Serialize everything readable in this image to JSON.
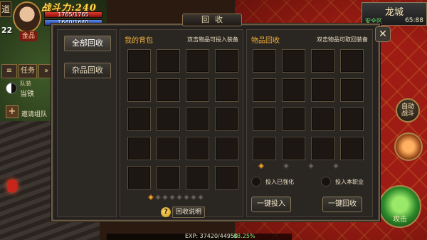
{
  "hud": {
    "dao": "道",
    "power": "战斗力:240",
    "level": "22",
    "hp_text": "1765/1765",
    "hp_fraction": 1.0,
    "mp_text": "1640/1640",
    "mp_fraction": 1.0,
    "name": "金品",
    "side_btn_task": "任务",
    "team_label": "队装",
    "team_name": "当铁",
    "invite": "邀请组队"
  },
  "map": {
    "name": "龙城",
    "safe": "安全区",
    "coords": "65:88"
  },
  "skills": {
    "fight": "自动\n战斗",
    "main": "攻击"
  },
  "exp": {
    "text": "EXP: 37420/44950",
    "pct": "83.25%"
  },
  "panel": {
    "title": "回收",
    "close": "✕",
    "categories": [
      {
        "label": "全部回收",
        "active": true
      },
      {
        "label": "杂品回收",
        "active": false
      }
    ],
    "bag": {
      "title": "我的背包",
      "hint": "双击物品可投入装备",
      "rows": 5,
      "cols": 4,
      "page_count": 8,
      "current_page": 1
    },
    "recycle": {
      "title": "物品回收",
      "hint": "双击物品可取回装备",
      "rows": 4,
      "cols": 4,
      "page_count": 4,
      "current_page": 1,
      "option_enhanced": "投入已强化",
      "option_class": "投入本职业",
      "btn_put_all": "一键投入",
      "btn_recycle_all": "一键回收"
    },
    "help": "回收说明",
    "help_icon": "?"
  },
  "colors": {
    "accent_title": "#f2b23a",
    "safe_zone": "#6ae86a"
  }
}
